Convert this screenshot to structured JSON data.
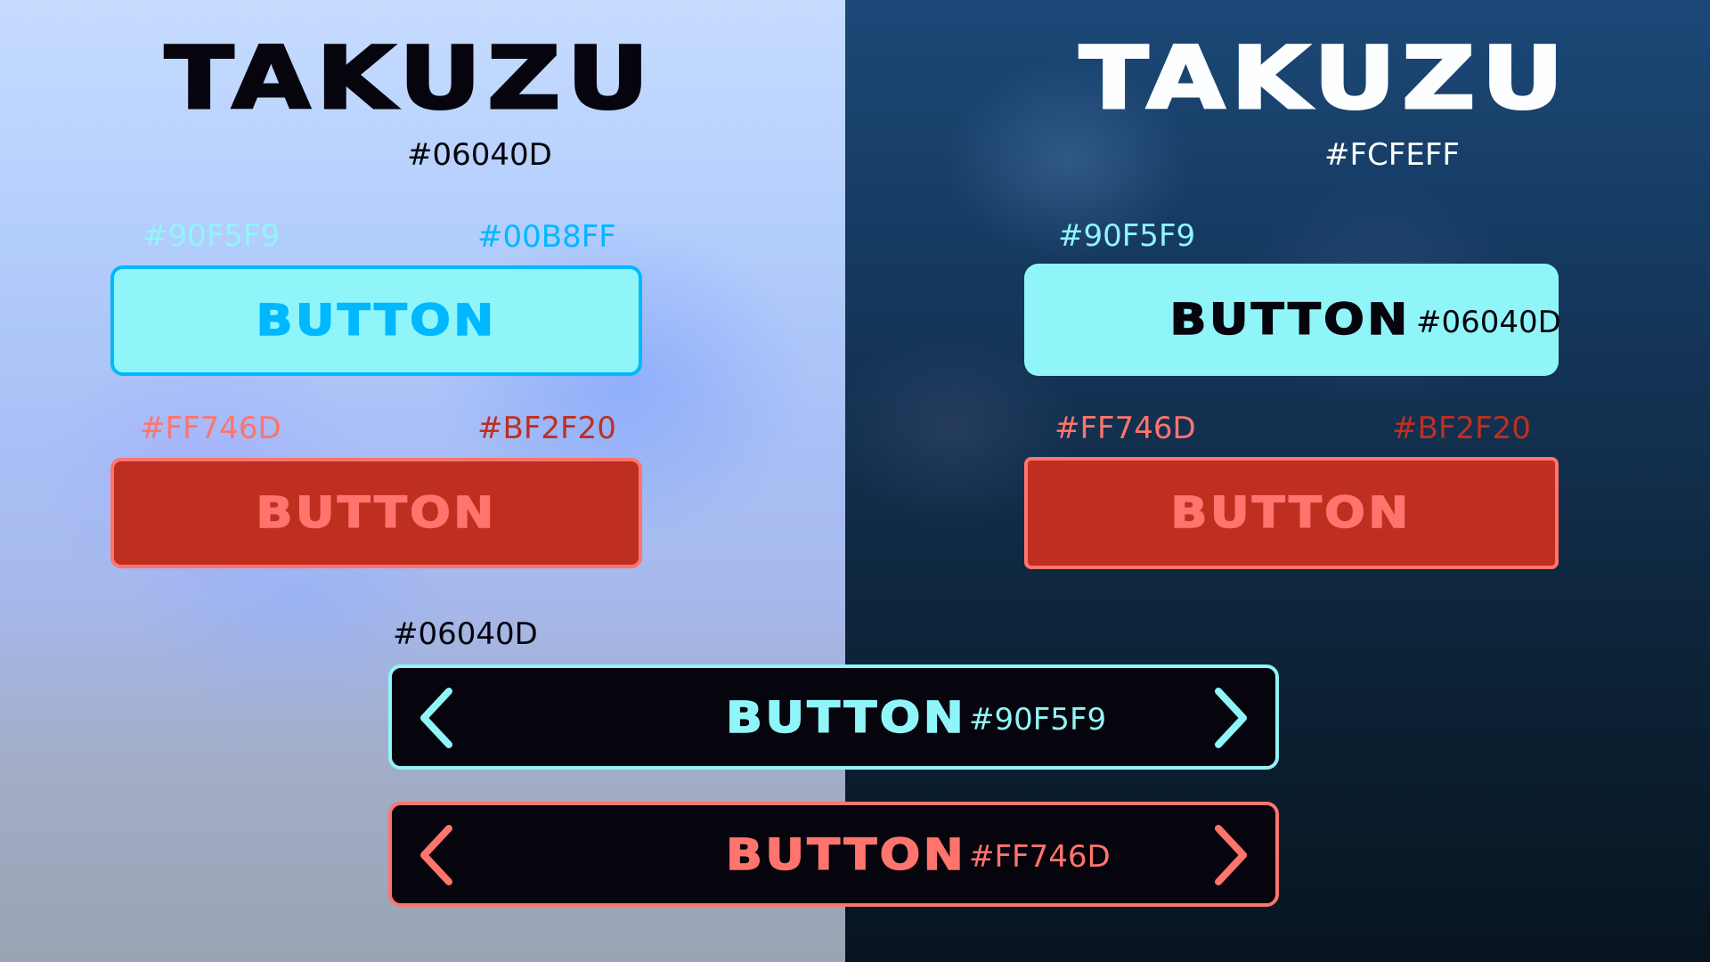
{
  "light_panel": {
    "title": "TAKUZU",
    "title_color_label": "#06040D",
    "button_primary": {
      "fill_label": "#90F5F9",
      "accent_label": "#00B8FF",
      "label": "BUTTON",
      "fill_color": "#90F5F9",
      "accent_color": "#00B8FF"
    },
    "button_danger": {
      "accent_label": "#FF746D",
      "fill_label": "#BF2F20",
      "label": "BUTTON",
      "fill_color": "#BF2F20",
      "accent_color": "#FF746D"
    }
  },
  "dark_panel": {
    "title": "TAKUZU",
    "title_color_label": "#FCFEFF",
    "button_primary": {
      "fill_label": "#90F5F9",
      "label": "BUTTON",
      "text_color_label": "#06040D",
      "fill_color": "#90F5F9",
      "text_color": "#06040D"
    },
    "button_danger": {
      "accent_label": "#FF746D",
      "fill_label": "#BF2F20",
      "label": "BUTTON",
      "fill_color": "#BF2F20",
      "accent_color": "#FF746D"
    }
  },
  "arrow_buttons": {
    "background_label": "#06040D",
    "background_color": "#06040D",
    "cyan": {
      "label": "BUTTON",
      "color_label": "#90F5F9",
      "color": "#90F5F9",
      "left_icon": "chevron-left-icon",
      "right_icon": "chevron-right-icon"
    },
    "coral": {
      "label": "BUTTON",
      "color_label": "#FF746D",
      "color": "#FF746D",
      "left_icon": "chevron-left-icon",
      "right_icon": "chevron-right-icon"
    }
  }
}
